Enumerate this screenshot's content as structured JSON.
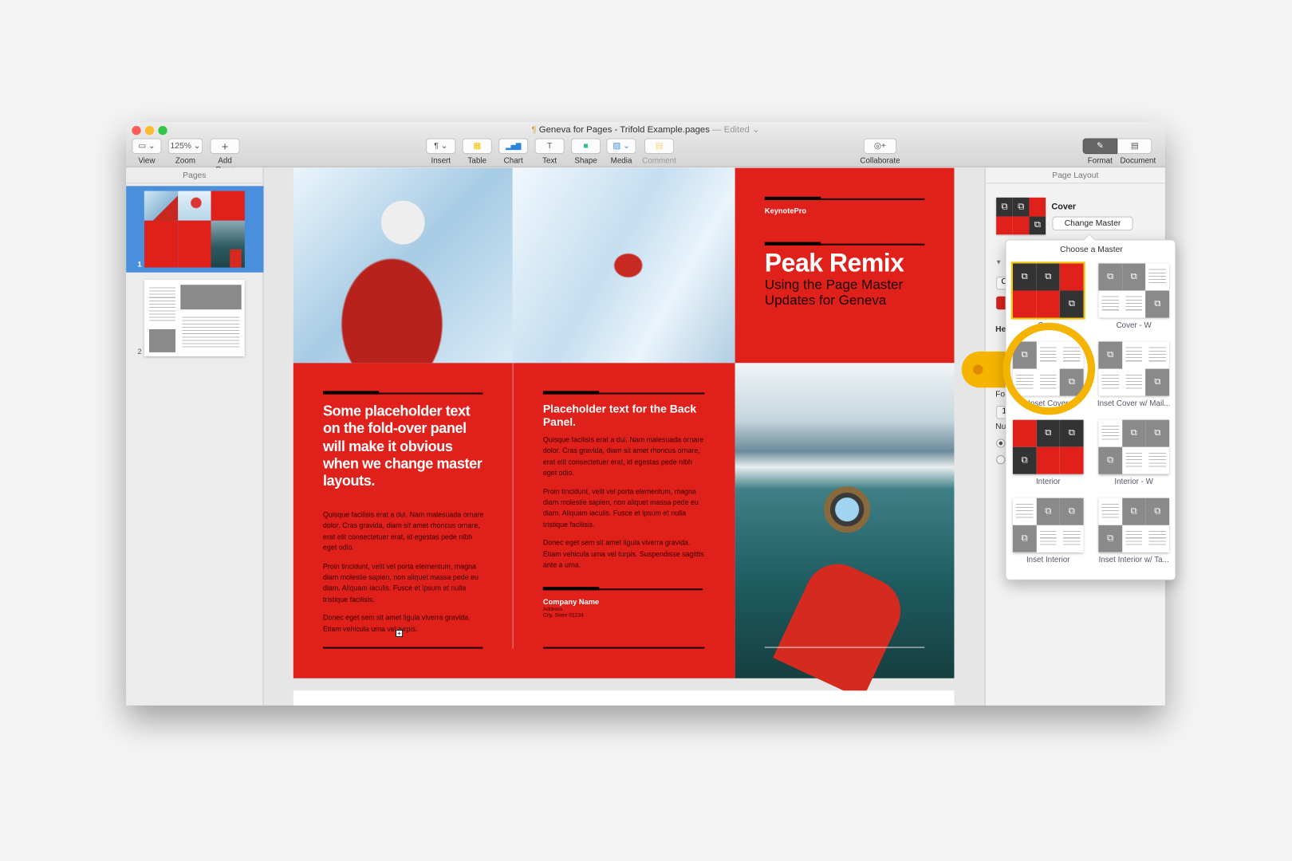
{
  "window": {
    "title": "Geneva for Pages - Trifold Example.pages",
    "edited": "— Edited ⌄"
  },
  "toolbar": {
    "left": [
      {
        "id": "view",
        "label": "View",
        "icon": "▭ ⌄"
      },
      {
        "id": "zoom",
        "label": "Zoom",
        "icon": "125% ⌄"
      },
      {
        "id": "add-page",
        "label": "Add Page",
        "icon": "+"
      }
    ],
    "center": [
      {
        "id": "insert",
        "label": "Insert",
        "icon": "¶ ⌄"
      },
      {
        "id": "table",
        "label": "Table",
        "icon": "▦"
      },
      {
        "id": "chart",
        "label": "Chart",
        "icon": "▂▅▇"
      },
      {
        "id": "text",
        "label": "Text",
        "icon": "T"
      },
      {
        "id": "shape",
        "label": "Shape",
        "icon": "■"
      },
      {
        "id": "media",
        "label": "Media",
        "icon": "▨ ⌄"
      },
      {
        "id": "comment",
        "label": "Comment",
        "icon": "▤"
      }
    ],
    "collaborate": {
      "label": "Collaborate",
      "icon": "◎+"
    },
    "right": [
      {
        "id": "format",
        "label": "Format",
        "icon": "✎"
      },
      {
        "id": "document",
        "label": "Document",
        "icon": "▤"
      }
    ]
  },
  "sidebar": {
    "title": "Pages",
    "pages": [
      {
        "number": "1",
        "selected": true
      },
      {
        "number": "2",
        "selected": false
      }
    ]
  },
  "document": {
    "cover": {
      "brand": "KeynotePro",
      "title": "Peak Remix",
      "subtitle": "Using the Page Master Updates for Geneva"
    },
    "fold_panel": {
      "heading": "Some placeholder text on the fold-over panel will make it obvious when we change master layouts.",
      "paragraphs": [
        "Quisque facilisis erat a dui. Nam malesuada ornare dolor. Cras gravida, diam sit amet rhoncus ornare, erat elit consectetuer erat, id egestas pede nibh eget odio.",
        "Proin tincidunt, velit vel porta elementum, magna diam molestie sapien, non aliquet massa pede eu diam. Aliquam iaculis. Fusce et ipsum et nulla tristique facilisis.",
        "Donec eget sem sit amet ligula viverra gravida. Etiam vehicula urna vel turpis."
      ]
    },
    "back_panel": {
      "heading": "Placeholder text for the Back Panel.",
      "paragraphs": [
        "Quisque facilisis erat a dui. Nam malesuada ornare dolor. Cras gravida, diam sit amet rhoncus ornare, erat elit consectetuer erat, id egestas pede nibh eget odio.",
        "Proin tincidunt, velit vel porta elementum, magna diam molestie sapien, non aliquet massa pede eu diam. Aliquam iaculis. Fusce et ipsum et nulla tristique facilisis.",
        "Donec eget sem sit amet ligula viverra gravida. Etiam vehicula urna vel turpis. Suspendisse sagittis ante a urna."
      ],
      "company": "Company Name",
      "address": "Address",
      "city": "City, State 01234"
    }
  },
  "inspector": {
    "title": "Page Layout",
    "master_name": "Cover",
    "change_master": "Change Master",
    "hidden_labels": [
      "He",
      "Fo",
      "Nu",
      "C",
      "1"
    ]
  },
  "popover": {
    "title": "Choose a Master",
    "masters": [
      {
        "label": "Cover",
        "style": "cover-red",
        "selected": true
      },
      {
        "label": "Cover - W",
        "style": "cover-white"
      },
      {
        "label": "Inset Cover",
        "style": "inset",
        "highlighted": true
      },
      {
        "label": "Inset Cover w/ Mail...",
        "style": "inset"
      },
      {
        "label": "Interior",
        "style": "interior-red"
      },
      {
        "label": "Interior - W",
        "style": "interior-white"
      },
      {
        "label": "Inset Interior",
        "style": "inset-interior"
      },
      {
        "label": "Inset Interior w/ Ta...",
        "style": "inset-interior"
      }
    ]
  },
  "colors": {
    "accent_red": "#e0201b",
    "selection_blue": "#4a8fdb",
    "highlight_yellow": "#f5b400"
  }
}
